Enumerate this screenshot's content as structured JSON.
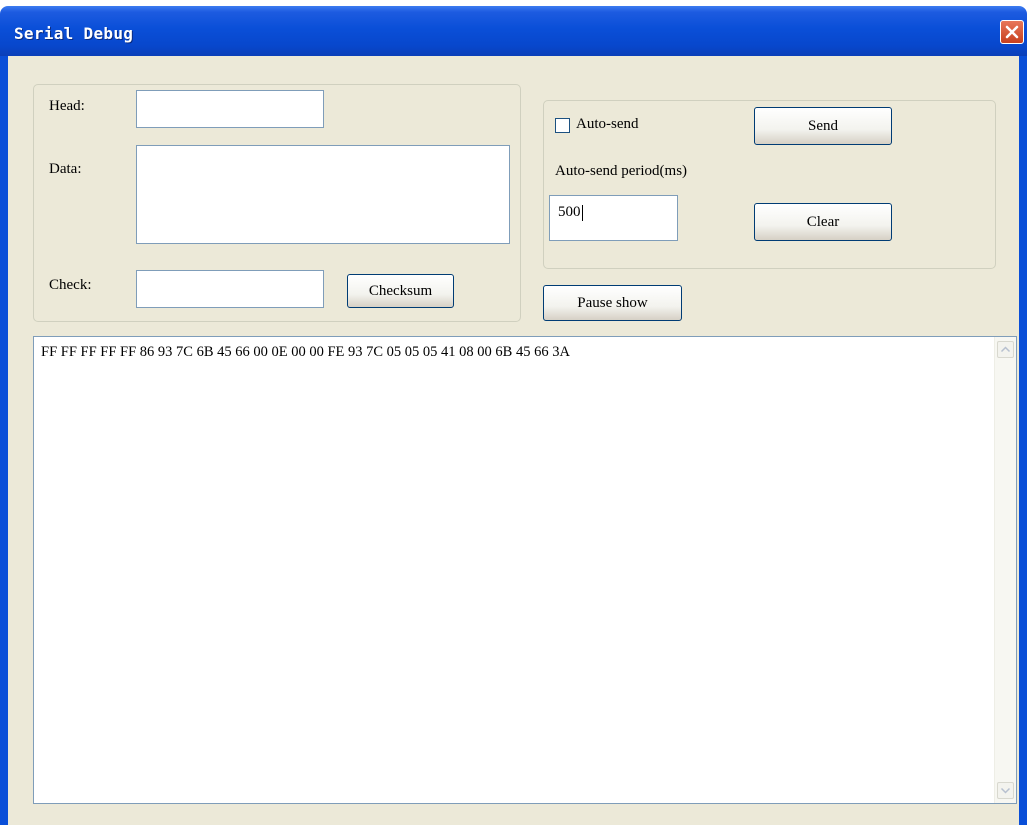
{
  "window": {
    "title": "Serial Debug"
  },
  "frame": {
    "head_label": "Head:",
    "head_value": "",
    "data_label": "Data:",
    "data_value": "",
    "check_label": "Check:",
    "check_value": "",
    "checksum_button": "Checksum"
  },
  "send_panel": {
    "autosend_label": "Auto-send",
    "autosend_checked": false,
    "send_button": "Send",
    "period_label": "Auto-send period(ms)",
    "period_value": "500",
    "clear_button": "Clear"
  },
  "pause_button": "Pause show",
  "output": {
    "text": "FF FF FF FF FF 86 93 7C 6B 45 66 00 0E 00 00 FE 93 7C 05 05 05 41 08 00 6B 45 66 3A"
  },
  "icons": {
    "close": "close-icon",
    "scroll_up": "scroll-up-arrow-icon",
    "scroll_down": "scroll-down-arrow-icon"
  },
  "colors": {
    "titlebar": "#0a4fd8",
    "client": "#ece9d8",
    "close": "#d5512e"
  }
}
